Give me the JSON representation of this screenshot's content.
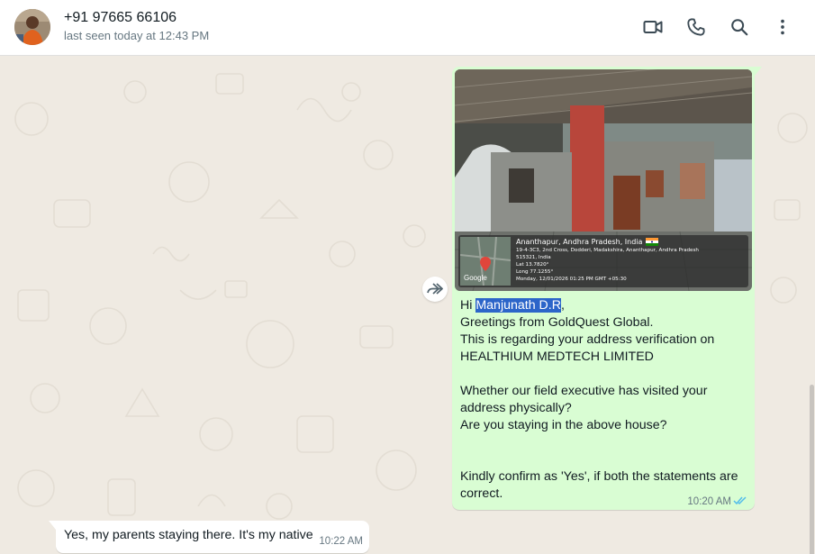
{
  "header": {
    "contact_name": "+91 97665 66106",
    "status": "last seen today at 12:43 PM",
    "icons": [
      "video-call-icon",
      "voice-call-icon",
      "search-icon",
      "menu-icon"
    ]
  },
  "messages": {
    "outgoing": {
      "greeting_prefix": "Hi ",
      "highlighted_name": "Manjunath D.R",
      "greeting_suffix": ",",
      "body": "Greetings from GoldQuest Global.\nThis is regarding your address verification on HEALTHIUM MEDTECH LIMITED\n\nWhether our field executive has visited your address physically?\nAre you staying in the above house?\n\n\nKindly confirm as 'Yes', if both the statements are correct.",
      "time": "10:20 AM",
      "photo": {
        "city": "Ananthapur, Andhra Pradesh, India",
        "address_line1": "19-4-3C3, 2nd Cross, Dodderi, Madakshira, Ananthapur, Andhra Pradesh",
        "address_line2": "515321, India",
        "lat": "Lat 13.7820°",
        "long": "Long 77.1255°",
        "timestamp": "Monday, 12/01/2026 01:25 PM GMT +05:30",
        "map_brand": "Google"
      }
    },
    "incoming": {
      "text": "Yes, my parents staying there. It's my native",
      "time": "10:22 AM"
    }
  },
  "colors": {
    "chat_bg": "#efeae2",
    "outgoing_bubble": "#d9fdd3",
    "incoming_bubble": "#ffffff",
    "read_ticks": "#53bdeb",
    "highlight": "#2c65c9"
  }
}
